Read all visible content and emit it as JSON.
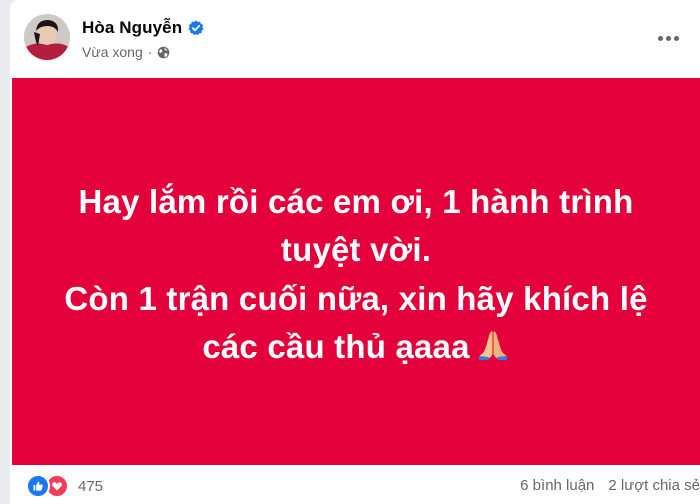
{
  "post": {
    "author": {
      "name": "Hòa Nguyễn",
      "verified": true
    },
    "meta": {
      "time": "Vừa xong",
      "separator": "·",
      "privacy_icon": "globe-icon"
    },
    "more_icon": "more-horizontal-icon",
    "background_color": "#e4003a",
    "text_lines": [
      "Hay lắm rồi các em ơi, 1 hành trình",
      "tuyệt vời.",
      "Còn 1 trận cuối nữa, xin hãy khích lệ",
      "các cầu thủ ạaaa"
    ],
    "emoji": "folded-hands-emoji"
  },
  "footer": {
    "reaction_icons": [
      "like-icon",
      "love-icon"
    ],
    "reaction_count": "475",
    "comments": "6 bình luận",
    "shares": "2 lượt chia sẻ"
  }
}
